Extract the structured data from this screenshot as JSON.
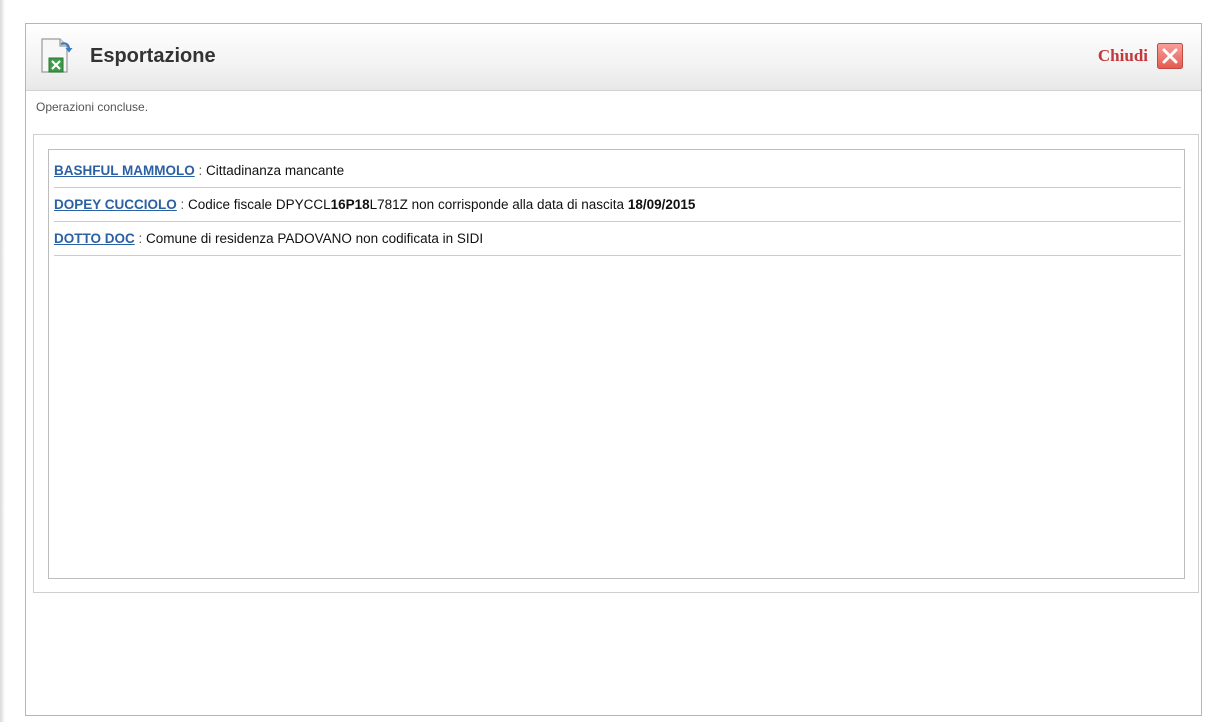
{
  "dialog": {
    "title": "Esportazione",
    "icon": "excel-export-icon",
    "close_label": "Chiudi",
    "close_icon": "close-icon"
  },
  "status": "Operazioni concluse.",
  "messages": [
    {
      "name": "BASHFUL MAMMOLO",
      "separator": " : ",
      "text": "Cittadinanza mancante"
    },
    {
      "name": "DOPEY CUCCIOLO",
      "separator": " : ",
      "text_prefix": "Codice fiscale DPYCCL",
      "text_bold_code": "16P18",
      "text_code_suffix": "L781Z non corrisponde alla data di nascita ",
      "text_bold_date": "18/09/2015"
    },
    {
      "name": "DOTTO DOC",
      "separator": " : ",
      "text": "Comune di residenza PADOVANO non codificata in SIDI"
    }
  ],
  "colors": {
    "link": "#2b61a4",
    "close_accent": "#c0393b",
    "close_button_bg": "#f0807a"
  }
}
